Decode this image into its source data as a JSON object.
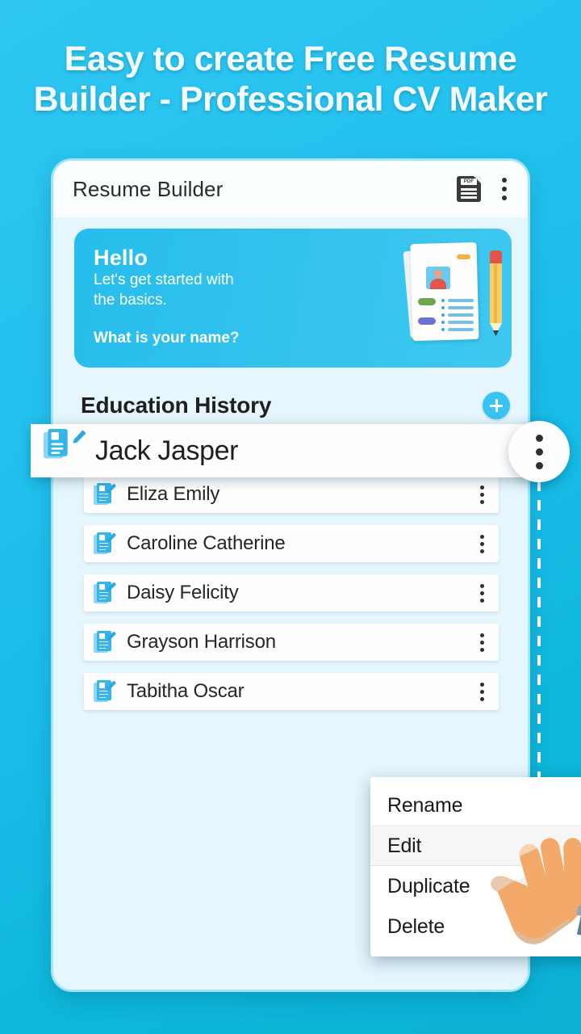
{
  "promo": {
    "headline": "Easy to create Free Resume\nBuilder - Professional CV Maker"
  },
  "app": {
    "appbar": {
      "title": "Resume Builder",
      "pdf_label": "PDF",
      "pdf_icon": "pdf-document-icon",
      "overflow_icon": "kebab-menu-icon"
    },
    "hello_card": {
      "greeting": "Hello",
      "subtitle": "Let's get started with\nthe basics.",
      "question": "What is your name?",
      "illustration": "resume-document-pencil-illustration"
    },
    "section": {
      "title": "Education History",
      "add_icon": "plus-icon"
    },
    "highlighted_entry": {
      "name": "Jack Jasper",
      "icon": "document-edit-icon",
      "overflow_icon": "kebab-menu-icon"
    },
    "entries": [
      {
        "name": "Eliza Emily",
        "icon": "document-edit-icon",
        "overflow_icon": "kebab-menu-icon"
      },
      {
        "name": "Caroline Catherine",
        "icon": "document-edit-icon",
        "overflow_icon": "kebab-menu-icon"
      },
      {
        "name": "Daisy Felicity",
        "icon": "document-edit-icon",
        "overflow_icon": "kebab-menu-icon"
      },
      {
        "name": "Grayson Harrison",
        "icon": "document-edit-icon",
        "overflow_icon": "kebab-menu-icon"
      },
      {
        "name": "Tabitha Oscar",
        "icon": "document-edit-icon",
        "overflow_icon": "kebab-menu-icon"
      }
    ],
    "context_menu": {
      "items": [
        {
          "label": "Rename",
          "selected": false
        },
        {
          "label": "Edit",
          "selected": true
        },
        {
          "label": "Duplicate",
          "selected": false
        },
        {
          "label": "Delete",
          "selected": false
        }
      ]
    },
    "cursor": {
      "icon": "hand-pointer-illustration"
    }
  },
  "colors": {
    "background_top": "#2ec6f0",
    "background_bottom": "#0bb2d6",
    "accent_blue": "#38c4f2",
    "card_background": "#e6f6fd",
    "hello_card": "#27bdec",
    "menu_selected": "#f6f6f6",
    "headline_text": "#f2fbff"
  }
}
